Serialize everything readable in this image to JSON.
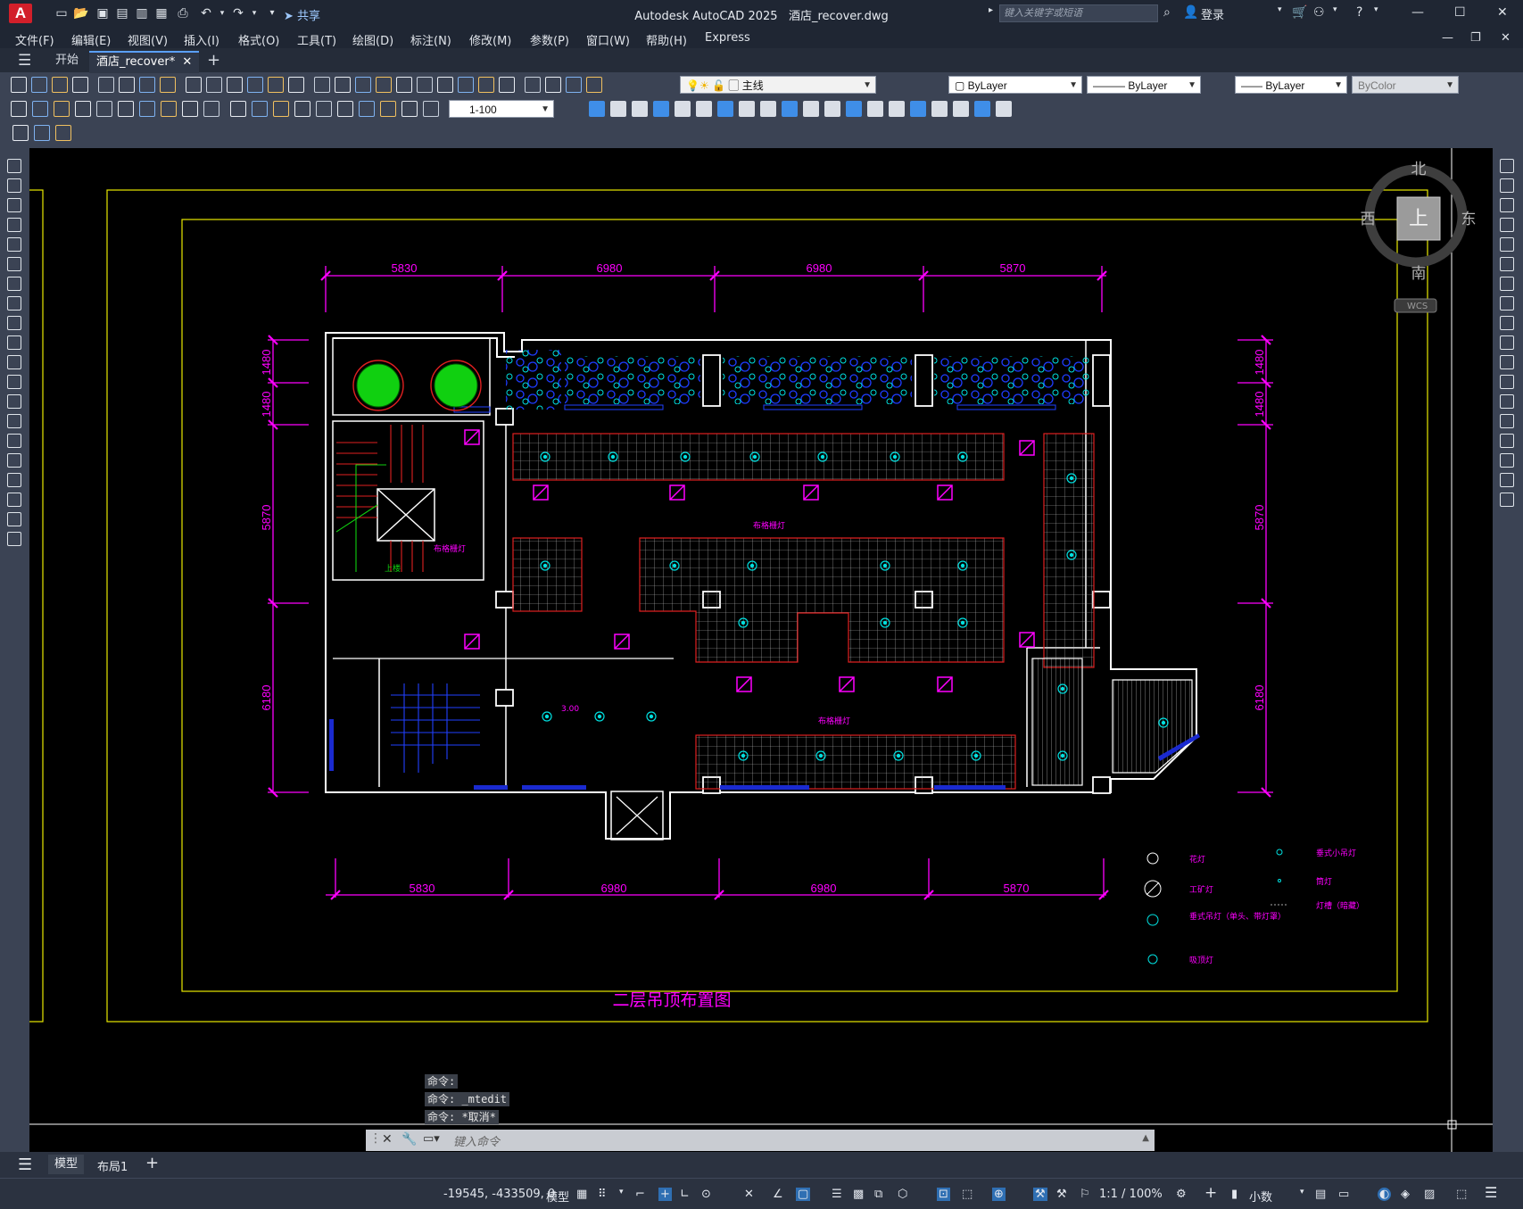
{
  "app": {
    "title": "Autodesk AutoCAD 2025",
    "file": "酒店_recover.dwg",
    "logo": "A",
    "share_label": "共享",
    "search_placeholder": "键入关键字或短语",
    "login_label": "登录"
  },
  "menus": [
    "文件(F)",
    "编辑(E)",
    "视图(V)",
    "插入(I)",
    "格式(O)",
    "工具(T)",
    "绘图(D)",
    "标注(N)",
    "修改(M)",
    "参数(P)",
    "窗口(W)",
    "帮助(H)",
    "Express"
  ],
  "tabs": [
    {
      "label": "开始",
      "active": false
    },
    {
      "label": "酒店_recover*",
      "active": true
    }
  ],
  "layer_toolbar": {
    "layer_name": "主线",
    "color": "ByLayer",
    "linetype": "ByLayer",
    "lineweight": "ByLayer",
    "plotstyle": "ByColor"
  },
  "dim_toolbar": {
    "scale": "1-100"
  },
  "viewcube": {
    "north": "北",
    "south": "南",
    "east": "东",
    "west": "西",
    "top": "上",
    "wcs": "WCS"
  },
  "drawing": {
    "title": "二层吊顶布置图",
    "dims_top": [
      "5830",
      "6980",
      "6980",
      "5870"
    ],
    "dims_bottom": [
      "5830",
      "6980",
      "6980",
      "5870"
    ],
    "dims_left": [
      "1480",
      "1480",
      "5870",
      "6180"
    ],
    "dims_right": [
      "1480",
      "1480",
      "5870",
      "6180"
    ],
    "notes": [
      "布格栅灯",
      "布格栅灯",
      "布格栅灯",
      "上楼",
      "3.00"
    ],
    "legend": [
      {
        "label": "花灯"
      },
      {
        "label": "工矿灯"
      },
      {
        "label": "垂式吊灯（单头、带灯罩）"
      },
      {
        "label": "吸顶灯"
      },
      {
        "label": "垂式小吊灯"
      },
      {
        "label": "筒灯"
      },
      {
        "label": "灯槽（暗藏）"
      }
    ],
    "colors": {
      "magenta": "#ff00ff",
      "yellow": "#e8e800",
      "white": "#ffffff",
      "red": "#e02020",
      "cyan": "#00e0e0",
      "blue": "#2040ff",
      "green": "#10d010"
    }
  },
  "command": {
    "history": [
      "命令:",
      "命令: _mtedit",
      "命令: *取消*"
    ],
    "placeholder": "键入命令"
  },
  "layout_tabs": [
    "模型",
    "布局1"
  ],
  "status": {
    "coords": "-19545, -433509, 0",
    "model": "模型",
    "scale": "1:1 / 100%",
    "units": "小数"
  }
}
